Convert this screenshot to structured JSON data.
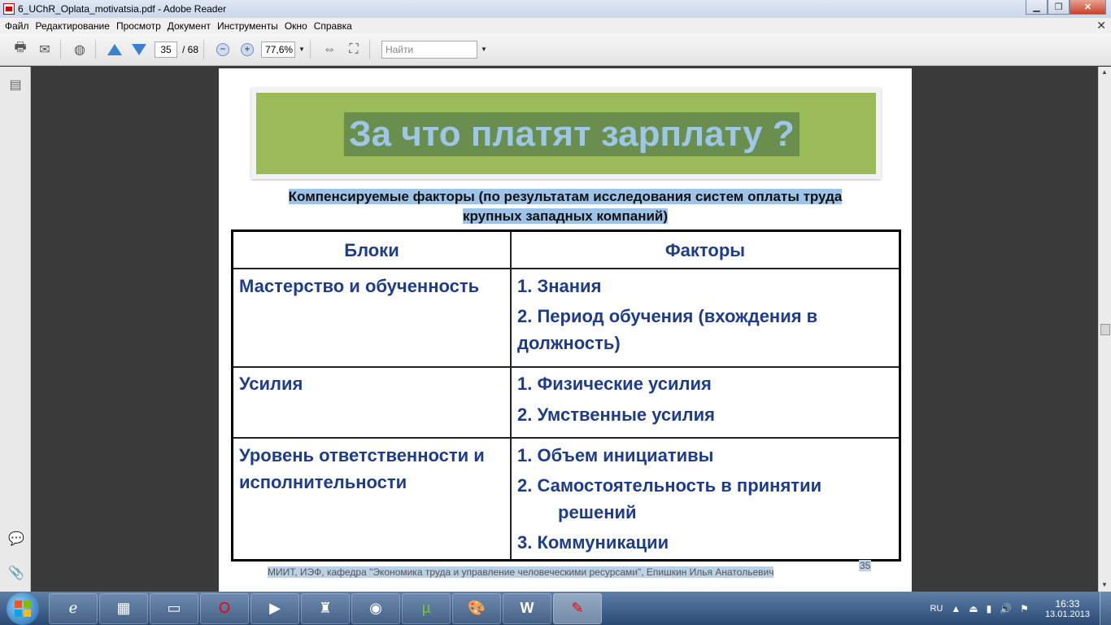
{
  "window": {
    "title": "6_UChR_Oplata_motivatsia.pdf - Adobe Reader"
  },
  "menu": [
    "Файл",
    "Редактирование",
    "Просмотр",
    "Документ",
    "Инструменты",
    "Окно",
    "Справка"
  ],
  "toolbar": {
    "page_current": "35",
    "page_total": "/ 68",
    "zoom": "77,6%",
    "search_placeholder": "Найти"
  },
  "slide": {
    "title": "За что платят зарплату ?",
    "subtitle_line1": "Компенсируемые факторы (по результатам исследования систем оплаты труда",
    "subtitle_line2": "крупных западных компаний)",
    "table": {
      "headers": [
        "Блоки",
        "Факторы"
      ],
      "rows": [
        {
          "block": "Мастерство и обученность",
          "factors": [
            "1. Знания",
            "2. Период обучения (вхождения в",
            "должность)"
          ]
        },
        {
          "block": "Усилия",
          "factors": [
            "1. Физические усилия",
            "2. Умственные усилия"
          ]
        },
        {
          "block_line1": "Уровень ответственности и",
          "block_line2": "исполнительности",
          "factors": [
            "1. Объем инициативы",
            "2. Самостоятельность в принятии",
            "решений",
            "3. Коммуникации"
          ]
        }
      ]
    },
    "footer": "МИИТ, ИЭФ, кафедра \"Экономика труда и управление человеческими ресурсами\", Епишкин Илья Анатольевич",
    "page_number": "35"
  },
  "taskbar": {
    "lang": "RU",
    "time": "16:33",
    "date": "13.01.2013"
  },
  "colors": {
    "banner_green": "#9bbb59",
    "title_highlight": "#6a8e4e",
    "title_text": "#9ec6e6",
    "table_text": "#1f3c8c",
    "subtitle_highlight": "#9ec3e8"
  }
}
